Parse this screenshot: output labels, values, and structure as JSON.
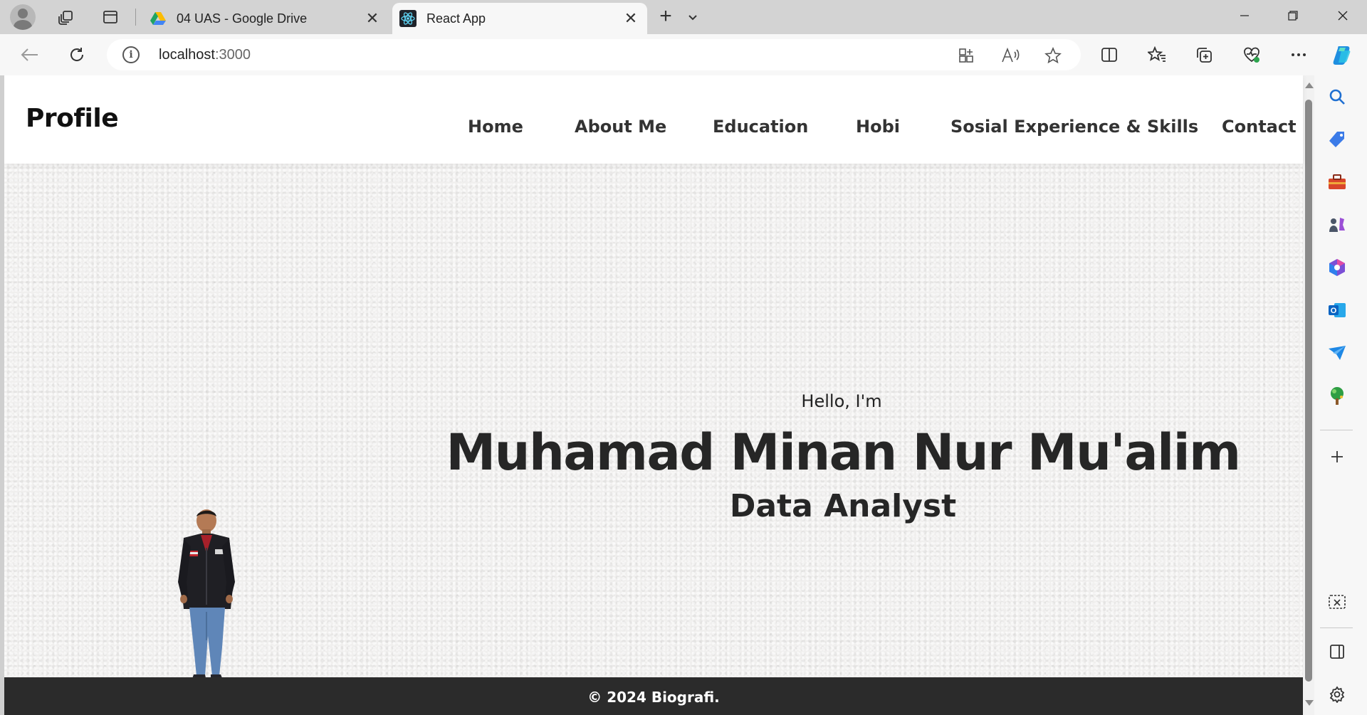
{
  "browser": {
    "tabs": [
      {
        "title": "04 UAS - Google Drive",
        "icon": "google-drive-icon",
        "active": false
      },
      {
        "title": "React App",
        "icon": "react-icon",
        "active": true
      }
    ],
    "url_host": "localhost",
    "url_port": ":3000"
  },
  "site": {
    "brand": "Profile",
    "nav": [
      "Home",
      "About Me",
      "Education",
      "Hobi",
      "Sosial Experience & Skills",
      "Contact"
    ],
    "hero": {
      "greeting": "Hello, I'm",
      "name": "Muhamad Minan Nur Mu'alim",
      "role": "Data Analyst"
    },
    "footer": "© 2024 Biografi."
  },
  "colors": {
    "footer_bg": "#2b2b2b",
    "hero_bg": "#f0efee",
    "text_dark": "#262626",
    "copilot_accent": "#1f8fe0"
  }
}
